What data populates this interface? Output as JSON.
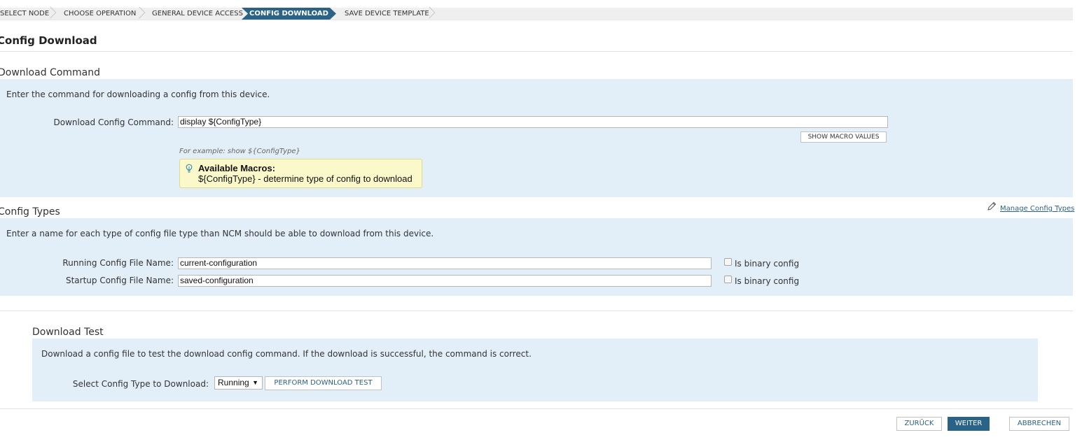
{
  "wizard": {
    "steps": [
      {
        "label": "SELECT NODE"
      },
      {
        "label": "CHOOSE OPERATION"
      },
      {
        "label": "GENERAL DEVICE ACCESS"
      },
      {
        "label": "CONFIG DOWNLOAD",
        "active": true
      },
      {
        "label": "SAVE DEVICE TEMPLATE"
      }
    ]
  },
  "page": {
    "title": "Config Download"
  },
  "download_command": {
    "title": "Download Command",
    "description": "Enter the command for downloading a config from this device.",
    "field_label": "Download Config Command:",
    "field_value": "display ${ConfigType}",
    "show_macro_button": "SHOW MACRO VALUES",
    "example": "For example: show ${ConfigType}",
    "macros_title": "Available Macros:",
    "macros_text": "${ConfigType} - determine type of config to download"
  },
  "config_types": {
    "title": "Config Types",
    "manage_link": "Manage Config Types",
    "description": "Enter a name for each type of config file type than NCM should be able to download from this device.",
    "rows": [
      {
        "label": "Running Config File Name:",
        "value": "current-configuration",
        "binary_label": "Is binary config",
        "binary_checked": false
      },
      {
        "label": "Startup Config File Name:",
        "value": "saved-configuration",
        "binary_label": "Is binary config",
        "binary_checked": false
      }
    ]
  },
  "download_test": {
    "title": "Download Test",
    "description": "Download a config file to test the download config command. If the download is successful, the command is correct.",
    "select_label": "Select Config Type to Download:",
    "select_value": "Running",
    "perform_button": "PERFORM DOWNLOAD TEST"
  },
  "footer": {
    "back_button": "ZURÜCK",
    "next_button": "WEITER",
    "cancel_button": "ABBRECHEN"
  },
  "colors": {
    "accent": "#2a6385",
    "panel_bg": "#e3eff8",
    "macro_bg": "#fbf8c9"
  }
}
